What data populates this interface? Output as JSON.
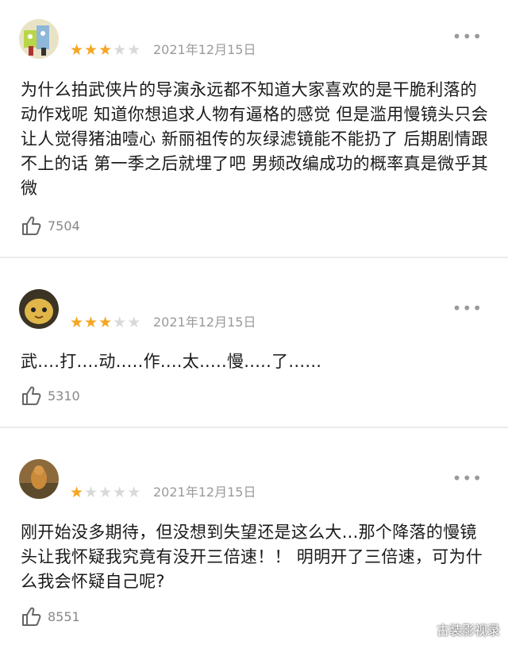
{
  "reviews": [
    {
      "date": "2021年12月15日",
      "rating": 3,
      "rating_max": 5,
      "text": "为什么拍武侠片的导演永远都不知道大家喜欢的是干脆利落的动作戏呢 知道你想追求人物有逼格的感觉 但是滥用慢镜头只会让人觉得猪油噎心 新丽祖传的灰绿滤镜能不能扔了 后期剧情跟不上的话 第一季之后就埋了吧 男频改编成功的概率真是微乎其微",
      "likes": "7504",
      "more": "•••"
    },
    {
      "date": "2021年12月15日",
      "rating": 3,
      "rating_max": 5,
      "text": "武....打....动.....作....太.....慢.....了......",
      "likes": "5310",
      "more": "•••"
    },
    {
      "date": "2021年12月15日",
      "rating": 1,
      "rating_max": 5,
      "text": "刚开始没多期待，但没想到失望还是这么大...那个降落的慢镜头让我怀疑我究竟有没开三倍速！！ 明明开了三倍速，可为什么我会怀疑自己呢?",
      "likes": "8551",
      "more": "•••"
    }
  ],
  "watermark": "古装影视录",
  "colors": {
    "star_on": "#f5a623",
    "star_off": "#d9d9d9",
    "meta": "#9a9a9a"
  },
  "icons": {
    "like": "thumbs-up-icon",
    "more": "more-dots-icon"
  }
}
